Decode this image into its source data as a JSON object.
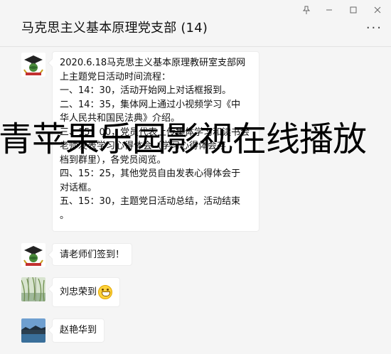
{
  "window": {
    "title": "马克思主义基本原理党支部 (14)",
    "pin_icon": "pin-icon",
    "minimize_icon": "minimize-icon",
    "maximize_icon": "maximize-icon",
    "close_icon": "close-icon",
    "more_label": "..."
  },
  "messages": [
    {
      "avatar": "university-logo-avatar",
      "lines": [
        "2020.6.18马克思主义基本原理教研室支部网",
        "上主题党日活动时间流程：",
        "一、14：30，活动开始网上对话框报到。",
        "二、14：35，集体网上通过小视频学习《中",
        "华人民共和国民法典》介绍。",
        "三、15：00，党员代表上传集体学习和读书会",
        "老师发表学习心得体会（学习心得体会存",
        "档到群里），各党员阅览。",
        "四、15：25，其他党员自由发表心得体会于",
        "对话框。",
        "五、15：30，主题党日活动总结，活动结束",
        "。"
      ]
    },
    {
      "avatar": "university-logo-avatar",
      "text": "请老师们签到！"
    },
    {
      "avatar": "willow-tree-avatar",
      "text": "刘忠荣到",
      "emoji": "grinning-emoji"
    },
    {
      "avatar": "lake-landscape-avatar",
      "text": "赵艳华到"
    }
  ],
  "overlay": {
    "watermark": "青苹果乐园影视在线播放"
  }
}
